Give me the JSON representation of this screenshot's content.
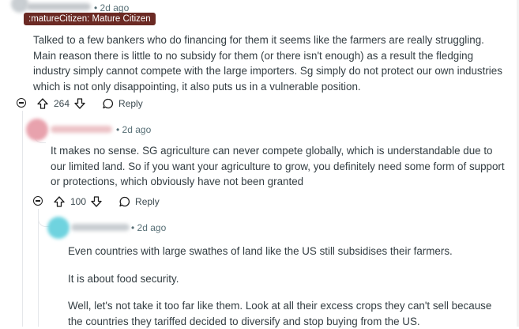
{
  "comment1": {
    "age": "• 2d ago",
    "flair": ":matureCitizen: Mature Citizen",
    "body": [
      "Talked to a few bankers who do financing for them it seems like the farmers are really struggling. Main reason there is little to no subsidy for them (or there isn't enough) as a result the fledging industry simply cannot compete with the large importers. Sg simply do not protect our own industries which is not only disappointing, it also puts us in a vulnerable position."
    ],
    "votes": "264",
    "reply_label": "Reply"
  },
  "comment2": {
    "age": "• 2d ago",
    "body": [
      "It makes no sense. SG agriculture can never compete globally, which is understandable due to our limited land. So if you want your agriculture to grow, you definitely need some form of support or protections, which obviously have not been granted"
    ],
    "votes": "100",
    "reply_label": "Reply"
  },
  "comment3": {
    "age": "• 2d ago",
    "body": [
      "Even countries with large swathes of land like the US still subsidises their farmers.",
      "It is about food security.",
      "Well, let's not take it too far like them. Look at all their excess crops they can't sell because the countries they tariffed decided to diversify and stop buying from the US."
    ]
  },
  "icons": {
    "upvote": "arrow-up-outline",
    "downvote": "arrow-down-outline",
    "reply": "speech-bubble-outline",
    "collapse": "circle-minus"
  },
  "colors": {
    "flair_bg": "#6b2a24",
    "meta_text": "#576f76",
    "body_text": "#333d42"
  }
}
